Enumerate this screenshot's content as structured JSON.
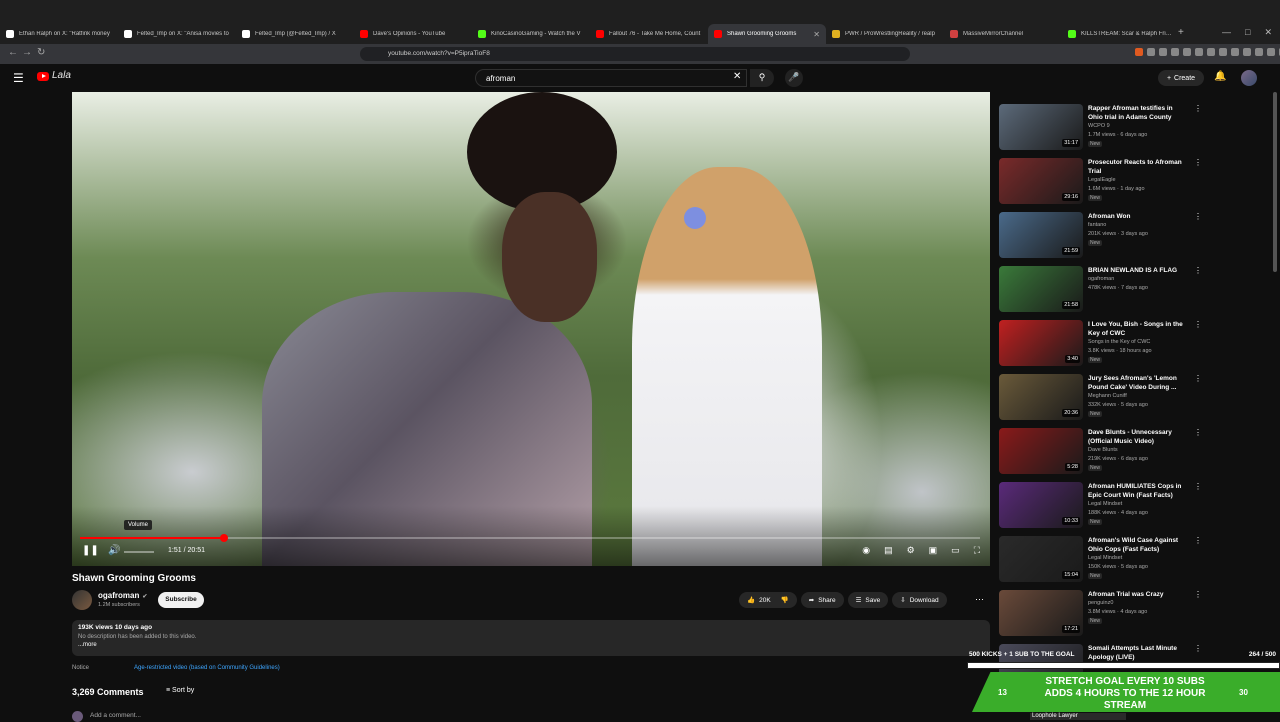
{
  "browser": {
    "tabs": [
      {
        "label": "Ethan Ralph on X: \"Ratfink money",
        "color": "#ffffff",
        "active": false
      },
      {
        "label": "Felted_Imp on X: \"Anisa movies to",
        "color": "#ffffff",
        "active": false
      },
      {
        "label": "Felted_Imp (@Felted_Imp) / X",
        "color": "#ffffff",
        "active": false
      },
      {
        "label": "Dave's Opinions - YouTube",
        "color": "#ff0000",
        "active": false
      },
      {
        "label": "KinoCasinoGaming - Watch the V",
        "color": "#53fc18",
        "active": false
      },
      {
        "label": "Fallout 76 - Take Me Home, Count",
        "color": "#ff0000",
        "active": false
      },
      {
        "label": "Shawn Grooming Grooms",
        "color": "#ff0000",
        "active": true
      },
      {
        "label": "PWR / ProWrestlingReality / realp",
        "color": "#e0b020",
        "active": false
      },
      {
        "label": "MassiveMirrorChannel",
        "color": "#d04040",
        "active": false
      },
      {
        "label": "KILLSTREAM: Scar & Ralph Friday",
        "color": "#53fc18",
        "active": false
      }
    ],
    "new_tab": "+",
    "url": "youtube.com/watch?v=P5ipraTioF8"
  },
  "header": {
    "brand": "Lala",
    "search_query": "afroman",
    "create_label": "Create"
  },
  "player": {
    "volume_tooltip": "Volume",
    "time": "1:51 / 20:51",
    "progress": 0.16
  },
  "video": {
    "title": "Shawn Grooming Grooms",
    "channel": "ogafroman",
    "subscribers": "1.2M subscribers",
    "subscribe_label": "Subscribe",
    "likes": "20K",
    "share_label": "Share",
    "save_label": "Save",
    "download_label": "Download",
    "stats": "193K views  10 days ago",
    "description": "No description has been added to this video.",
    "more_label": "...more",
    "notice_label": "Notice",
    "notice_link": "Age-restricted video (based on Community Guidelines)",
    "comments_count": "3,269 Comments",
    "sort_label": "Sort by",
    "add_comment": "Add a comment..."
  },
  "recommendations": [
    {
      "title": "Rapper Afroman testifies in Ohio trial in Adams County",
      "channel": "WCPO 9",
      "meta": "1.7M views · 6 days ago",
      "badge": "New",
      "duration": "31:17",
      "thumb": "#5c6a7a"
    },
    {
      "title": "Prosecutor Reacts to Afroman Trial",
      "channel": "LegalEagle",
      "meta": "1.6M views · 1 day ago",
      "badge": "New",
      "duration": "29:16",
      "thumb": "#7a2a2a"
    },
    {
      "title": "Afroman Won",
      "channel": "fantano",
      "meta": "201K views · 3 days ago",
      "badge": "New",
      "duration": "21:59",
      "thumb": "#4a6a8a"
    },
    {
      "title": "BRIAN NEWLAND IS A FLAG",
      "channel": "ogafroman",
      "meta": "478K views · 7 days ago",
      "badge": "",
      "duration": "21:58",
      "thumb": "#3a7a3a"
    },
    {
      "title": "I Love You, Bish - Songs in the Key of CWC",
      "channel": "Songs in the Key of CWC",
      "meta": "3.8K views · 18 hours ago",
      "badge": "New",
      "duration": "3:40",
      "thumb": "#c02020"
    },
    {
      "title": "Jury Sees Afroman's 'Lemon Pound Cake' Video During ...",
      "channel": "Meghann Cuniff",
      "meta": "332K views · 5 days ago",
      "badge": "New",
      "duration": "20:36",
      "thumb": "#6a5a3a"
    },
    {
      "title": "Dave Blunts - Unnecessary (Official Music Video)",
      "channel": "Dave Blunts",
      "meta": "219K views · 6 days ago",
      "badge": "New",
      "duration": "5:28",
      "thumb": "#8a1a1a"
    },
    {
      "title": "Afroman HUMILIATES Cops in Epic Court Win (Fast Facts)",
      "channel": "Legal Mindset",
      "meta": "188K views · 4 days ago",
      "badge": "New",
      "duration": "10:33",
      "thumb": "#5a2a7a"
    },
    {
      "title": "Afroman's Wild Case Against Ohio Cops (Fast Facts)",
      "channel": "Legal Mindset",
      "meta": "150K views · 5 days ago",
      "badge": "New",
      "duration": "15:04",
      "thumb": "#2a2a2a"
    },
    {
      "title": "Afroman Trial was Crazy",
      "channel": "penguinz0",
      "meta": "3.8M views · 4 days ago",
      "badge": "New",
      "duration": "17:21",
      "thumb": "#6a4a3a"
    },
    {
      "title": "Somali Attempts Last Minute Apology (LIVE)",
      "channel": "",
      "meta": "",
      "badge": "",
      "duration": "",
      "thumb": "#4a4a5a"
    }
  ],
  "overlay": {
    "goal_text": "500 KICKS + 1 SUB TO THE GOAL",
    "goal_count": "264 / 500",
    "stretch_text": "STRETCH GOAL EVERY 10 SUBS ADDS 4 HOURS TO THE 12 HOUR STREAM",
    "left_number": "13",
    "right_number": "30",
    "footer_text": "Loophole Lawyer"
  }
}
